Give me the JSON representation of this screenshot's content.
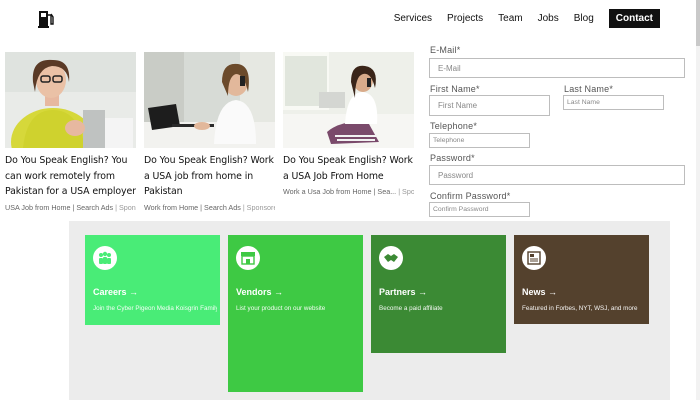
{
  "colors": {
    "tile_careers": "#49ec77",
    "tile_vendors": "#3ec944",
    "tile_partners": "#3b8a34",
    "tile_news": "#54412d",
    "nav_contact_bg": "#111111"
  },
  "header": {
    "logo_icon": "fuel-pump-icon",
    "nav": [
      "Services",
      "Projects",
      "Team",
      "Jobs",
      "Blog"
    ],
    "contact": "Contact"
  },
  "ads": [
    {
      "headline": "Do You Speak English? You can work remotely from Pakistan for a USA employer",
      "source": "USA Job from Home | Search Ads",
      "sponsor": "| Sponsored"
    },
    {
      "headline": "Do You Speak English? Work a USA job from home in Pakistan",
      "source": "Work from Home | Search Ads",
      "sponsor": "| Sponsored"
    },
    {
      "headline": "Do You Speak English? Work a USA Job From Home",
      "source": "Work a Usa Job from Home | Sea...",
      "sponsor": "| Sponsored"
    }
  ],
  "form": {
    "email_label": "E-Mail*",
    "email_placeholder": "E-Mail",
    "first_name_label": "First Name*",
    "first_name_placeholder": "First Name",
    "last_name_label": "Last Name*",
    "last_name_placeholder": "Last Name",
    "telephone_label": "Telephone*",
    "telephone_placeholder": "Telephone",
    "password_label": "Password*",
    "password_placeholder": "Password",
    "confirm_label": "Confirm Password*",
    "confirm_placeholder": "Confirm Password"
  },
  "tiles": [
    {
      "title": "Careers →",
      "desc": "Join the Cyber Pigeon Media Koisgrin Family!",
      "icon": "people-group-icon"
    },
    {
      "title": "Vendors →",
      "desc": "List your product on our website",
      "icon": "storefront-icon"
    },
    {
      "title": "Partners →",
      "desc": "Become a paid affiliate",
      "icon": "handshake-icon"
    },
    {
      "title": "News →",
      "desc": "Featured in Forbes, NYT, WSJ, and more",
      "icon": "newspaper-icon"
    }
  ]
}
